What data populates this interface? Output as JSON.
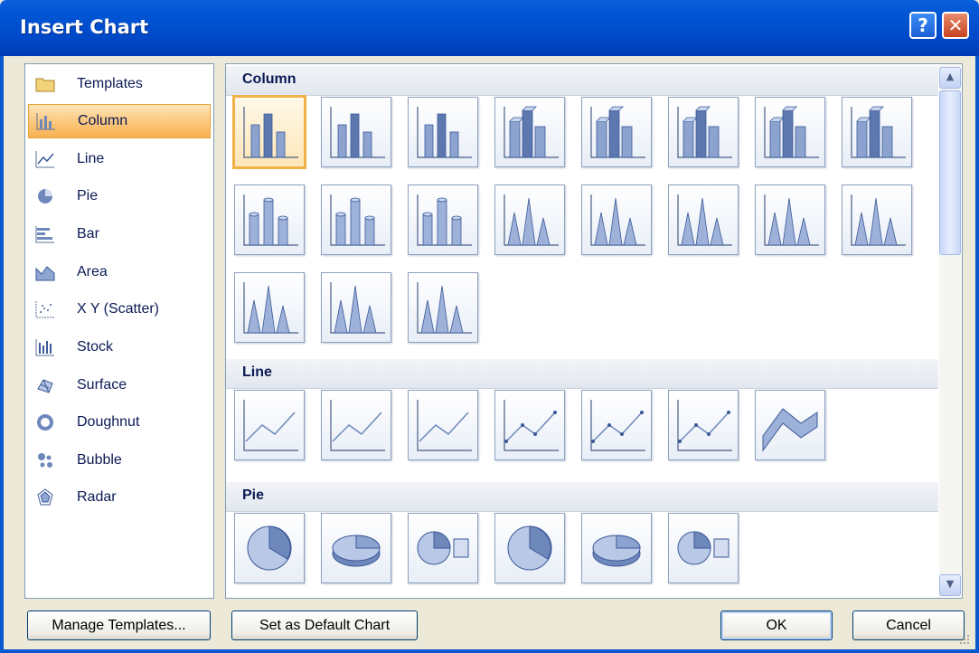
{
  "window": {
    "title": "Insert Chart",
    "help_label": "?",
    "close_label": "✕"
  },
  "categories": [
    {
      "label": "Templates",
      "icon": "folder-icon"
    },
    {
      "label": "Column",
      "icon": "column-chart-icon",
      "selected": true
    },
    {
      "label": "Line",
      "icon": "line-chart-icon"
    },
    {
      "label": "Pie",
      "icon": "pie-chart-icon"
    },
    {
      "label": "Bar",
      "icon": "bar-chart-icon"
    },
    {
      "label": "Area",
      "icon": "area-chart-icon"
    },
    {
      "label": "X Y (Scatter)",
      "icon": "scatter-chart-icon"
    },
    {
      "label": "Stock",
      "icon": "stock-chart-icon"
    },
    {
      "label": "Surface",
      "icon": "surface-chart-icon"
    },
    {
      "label": "Doughnut",
      "icon": "doughnut-chart-icon"
    },
    {
      "label": "Bubble",
      "icon": "bubble-chart-icon"
    },
    {
      "label": "Radar",
      "icon": "radar-chart-icon"
    }
  ],
  "sections": [
    {
      "title": "Column",
      "count": 19
    },
    {
      "title": "Line",
      "count": 7
    },
    {
      "title": "Pie",
      "count": 6
    }
  ],
  "buttons": {
    "manage_templates": "Manage Templates...",
    "set_default": "Set as Default Chart",
    "ok": "OK",
    "cancel": "Cancel"
  },
  "scroll_arrows": {
    "up": "▲",
    "down": "▼"
  },
  "colors": {
    "title_bar": "#0054E3",
    "selection": "#FBC980",
    "accent_blue": "#3B5998"
  }
}
